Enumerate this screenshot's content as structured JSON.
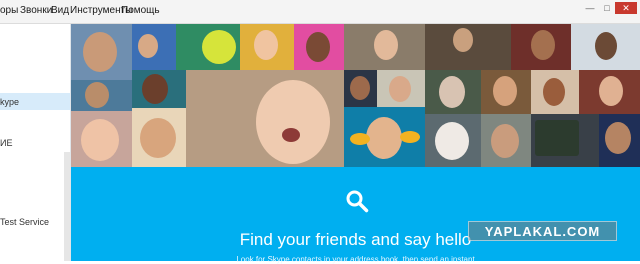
{
  "menubar": {
    "items": [
      "оры",
      "Звонки",
      "Вид",
      "Инструменты",
      "Помощь"
    ]
  },
  "sidebar": {
    "items": [
      "kype",
      "ИЕ",
      "Test Service"
    ]
  },
  "hero": {
    "title": "Find your friends and say hello",
    "subtitle": "Look for Skype contacts in your address book, then send an instant",
    "accent_color": "#00aff0",
    "icon": "search-icon"
  },
  "watermark": {
    "text": "YAPLAKAL.COM"
  },
  "window_controls": {
    "icons": [
      "minimize-icon",
      "maximize-icon",
      "close-icon"
    ]
  }
}
